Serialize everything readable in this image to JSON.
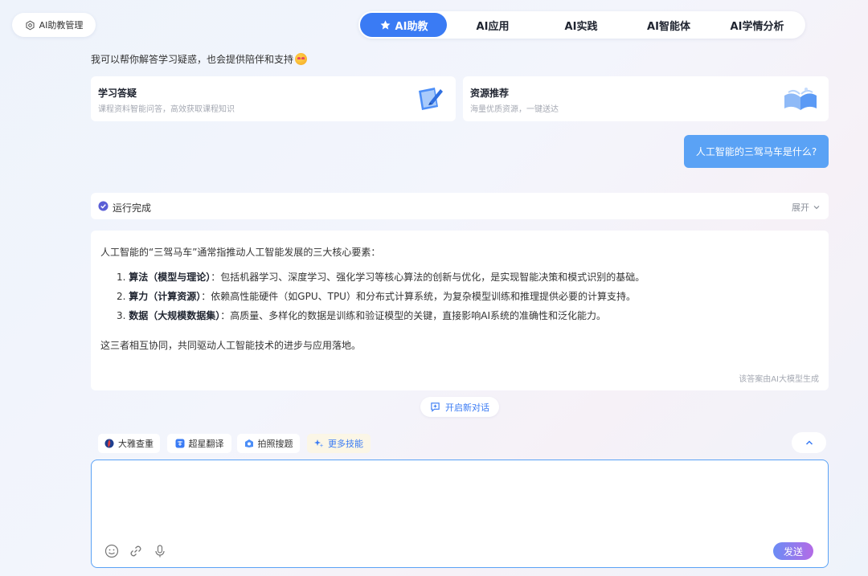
{
  "manage": {
    "label": "AI助教管理"
  },
  "nav": {
    "tabs": [
      {
        "label": "AI助教",
        "active": true
      },
      {
        "label": "AI应用"
      },
      {
        "label": "AI实践"
      },
      {
        "label": "AI智能体"
      },
      {
        "label": "AI学情分析"
      }
    ]
  },
  "greeting": "我可以帮你解答学习疑惑，也会提供陪伴和支持",
  "cards": [
    {
      "title": "学习答疑",
      "subtitle": "课程资料智能问答，高效获取课程知识"
    },
    {
      "title": "资源推荐",
      "subtitle": "海量优质资源，一键送达"
    }
  ],
  "user_message": "人工智能的三驾马车是什么?",
  "status": {
    "text": "运行完成",
    "expand": "展开"
  },
  "answer": {
    "intro": "人工智能的“三驾马车”通常指推动人工智能发展的三大核心要素：",
    "items": [
      {
        "num": "1.",
        "bold": "算法（模型与理论）",
        "text": "：包括机器学习、深度学习、强化学习等核心算法的创新与优化，是实现智能决策和模式识别的基础。"
      },
      {
        "num": "2.",
        "bold": "算力（计算资源）",
        "text": "：依赖高性能硬件（如GPU、TPU）和分布式计算系统，为复杂模型训练和推理提供必要的计算支持。"
      },
      {
        "num": "3.",
        "bold": "数据（大规模数据集）",
        "text": "：高质量、多样化的数据是训练和验证模型的关键，直接影响AI系统的准确性和泛化能力。"
      }
    ],
    "summary": "这三者相互协同，共同驱动人工智能技术的进步与应用落地。",
    "footer": "该答案由AI大模型生成"
  },
  "new_chat": "开启新对话",
  "skills": [
    {
      "label": "大雅查重"
    },
    {
      "label": "超星翻译"
    },
    {
      "label": "拍照搜题"
    },
    {
      "label": "更多技能"
    }
  ],
  "input": {
    "placeholder": "",
    "send": "发送"
  },
  "colors": {
    "accent": "#3a7bf4",
    "bubble": "#5aa2f5"
  }
}
